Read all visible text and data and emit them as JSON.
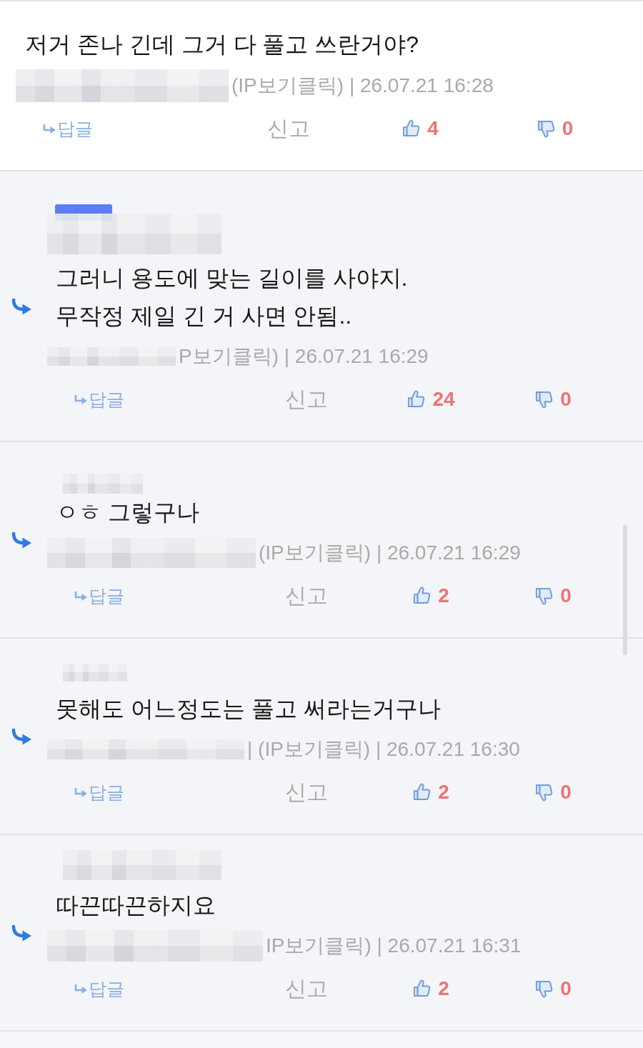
{
  "comments": [
    {
      "reply": false,
      "best": false,
      "author_blurred": false,
      "text": "저거 존나 긴데 그거 다 풀고 쓰란거야?",
      "meta_blurred": true,
      "meta": "(IP보기클릭) | 26.07.21 16:28",
      "reply_label": "답글",
      "report_label": "신고",
      "likes": "4",
      "dislikes": "0"
    },
    {
      "reply": true,
      "best": true,
      "author_blurred": true,
      "text": "그러니 용도에 맞는 길이를 사야지.\n무작정 제일 긴 거 사면 안됨..",
      "meta_blurred": true,
      "meta": "P보기클릭) | 26.07.21 16:29",
      "reply_label": "답글",
      "report_label": "신고",
      "likes": "24",
      "dislikes": "0"
    },
    {
      "reply": true,
      "best": false,
      "author_blurred": true,
      "text": "ㅇㅎ 그렇구나",
      "meta_blurred": true,
      "meta": "(IP보기클릭) | 26.07.21 16:29",
      "reply_label": "답글",
      "report_label": "신고",
      "likes": "2",
      "dislikes": "0"
    },
    {
      "reply": true,
      "best": false,
      "author_blurred": true,
      "text": "못해도 어느정도는 풀고 써라는거구나",
      "meta_blurred": true,
      "meta": "| (IP보기클릭) | 26.07.21 16:30",
      "reply_label": "답글",
      "report_label": "신고",
      "likes": "2",
      "dislikes": "0"
    },
    {
      "reply": true,
      "best": false,
      "author_blurred": true,
      "text": "따끈따끈하지요",
      "meta_blurred": true,
      "meta": "IP보기클릭) | 26.07.21 16:31",
      "reply_label": "답글",
      "report_label": "신고",
      "likes": "2",
      "dislikes": "0"
    }
  ]
}
